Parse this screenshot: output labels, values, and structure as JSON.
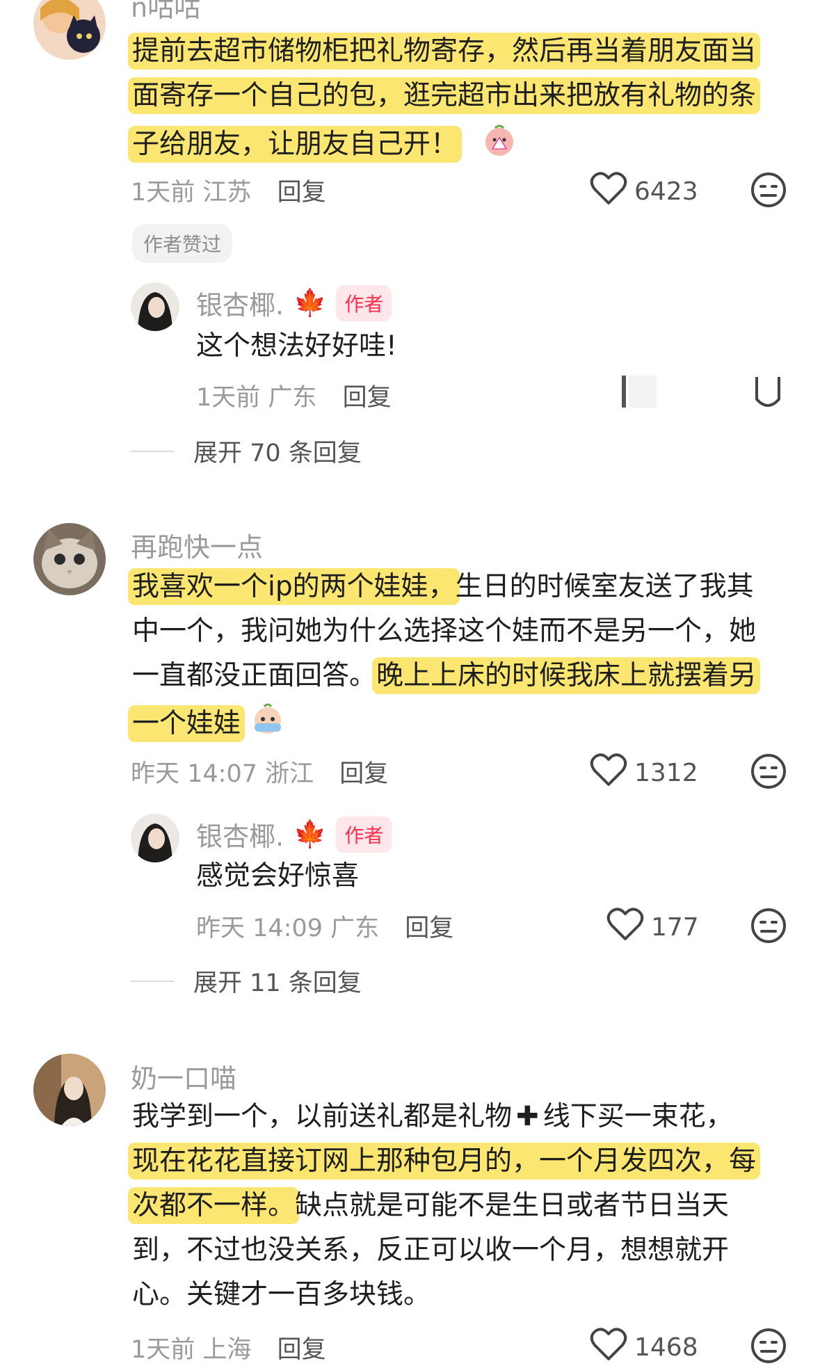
{
  "comments": [
    {
      "username": "n咕咕",
      "lines": [
        [
          {
            "t": "提前去超市储物柜把礼物寄存，然后再当着朋友面当",
            "h": true
          }
        ],
        [
          {
            "t": "面寄存一个自己的包，逛完超市出来把放有礼物的条",
            "h": true
          }
        ],
        [
          {
            "t": "子给朋友，让朋友自己开！",
            "h": true
          }
        ]
      ],
      "time": "1天前",
      "location": "江苏",
      "reply_label": "回复",
      "likes": "6423",
      "badge": "作者赞过",
      "reply": {
        "username": "银杏椰.",
        "author_tag": "作者",
        "text": "这个想法好好哇!",
        "time": "1天前",
        "location": "广东",
        "reply_label": "回复"
      },
      "expand": "展开 70 条回复"
    },
    {
      "username": "再跑快一点",
      "lines": [
        [
          {
            "t": "我喜欢一个ip的两个娃娃，",
            "h": true
          },
          {
            "t": "生日的时候室友送了我其",
            "h": false
          }
        ],
        [
          {
            "t": "中一个，我问她为什么选择这个娃而不是另一个，她",
            "h": false
          }
        ],
        [
          {
            "t": "一直都没正面回答。",
            "h": false
          },
          {
            "t": "晚上上床的时候我床上就摆着另",
            "h": true
          }
        ],
        [
          {
            "t": "一个娃娃",
            "h": true
          }
        ]
      ],
      "time": "昨天 14:07",
      "location": "浙江",
      "reply_label": "回复",
      "likes": "1312",
      "reply": {
        "username": "银杏椰.",
        "author_tag": "作者",
        "text": "感觉会好惊喜",
        "time": "昨天 14:09",
        "location": "广东",
        "reply_label": "回复",
        "likes": "177"
      },
      "expand": "展开 11 条回复"
    },
    {
      "username": "奶一口喵",
      "lines": [
        [
          {
            "t": "我学到一个，以前送礼都是礼物",
            "h": false
          },
          {
            "t": "✚",
            "h": false
          },
          {
            "t": "线下买一束花，",
            "h": false
          }
        ],
        [
          {
            "t": "现在花花直接订网上那种包月的，一个月发四次，每",
            "h": true
          }
        ],
        [
          {
            "t": "次都不一样。",
            "h": true
          },
          {
            "t": "缺点就是可能不是生日或者节日当天",
            "h": false
          }
        ],
        [
          {
            "t": "到，不过也没关系，反正可以收一个月，想想就开",
            "h": false
          }
        ],
        [
          {
            "t": "心。关键才一百多块钱。",
            "h": false
          }
        ]
      ],
      "time": "1天前",
      "location": "上海",
      "reply_label": "回复",
      "likes": "1468"
    }
  ],
  "colors": {
    "highlight": "#fbe672",
    "author_tag_bg": "#fde7ea",
    "author_tag_fg": "#ff2e4d",
    "leaf": "#e34b16"
  }
}
